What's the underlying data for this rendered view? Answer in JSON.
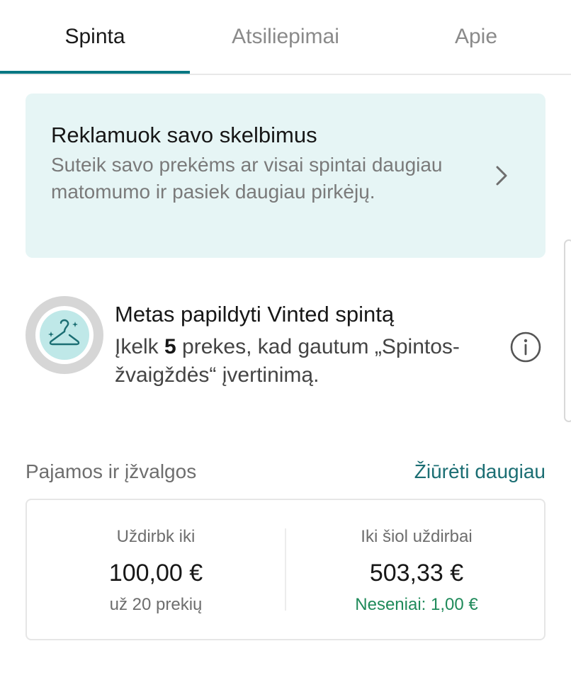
{
  "tabs": [
    {
      "label": "Spinta",
      "active": true
    },
    {
      "label": "Atsiliepimai",
      "active": false
    },
    {
      "label": "Apie",
      "active": false
    }
  ],
  "promo": {
    "title": "Reklamuok savo skelbimus",
    "description": "Suteik savo prekėms ar visai spintai daugiau matomumo ir pasiek daugiau pirkėjų.",
    "icon": "chevron-right-icon"
  },
  "closet_star": {
    "title": "Metas papildyti Vinted spintą",
    "desc_prefix": "Įkelk ",
    "desc_count": "5",
    "desc_suffix": " prekes, kad gautum „Spintos-žvaigždės“ įvertinimą.",
    "badge_icon": "hanger-sparkle-icon",
    "info_icon": "info-icon"
  },
  "earnings": {
    "heading": "Pajamos ir įžvalgos",
    "link": "Žiūrėti daugiau",
    "left": {
      "label": "Uždirbk iki",
      "amount": "100,00 €",
      "sub": "už 20 prekių"
    },
    "right": {
      "label": "Iki šiol uždirbai",
      "amount": "503,33 €",
      "sub": "Neseniai: 1,00 €"
    }
  },
  "colors": {
    "accent": "#007782",
    "promo_bg": "#e6f5f5",
    "link": "#1b6e73",
    "positive": "#1f8a5a"
  }
}
